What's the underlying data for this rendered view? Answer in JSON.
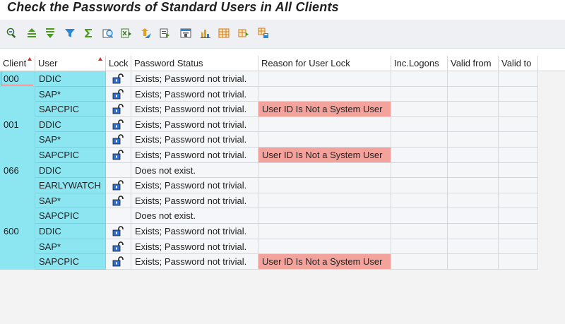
{
  "window": {
    "title": "Check the Passwords of Standard Users in All Clients"
  },
  "toolbar": {
    "icons": [
      "details-icon",
      "sort-ascending-icon",
      "sort-descending-icon",
      "filter-icon",
      "sum-icon",
      "print-preview-icon",
      "export-spreadsheet-icon",
      "local-file-icon",
      "mail-icon",
      "abc-analysis-icon",
      "graphic-icon",
      "layout-icon",
      "select-layout-icon",
      "save-layout-icon"
    ]
  },
  "table": {
    "columns": [
      {
        "key": "client",
        "label": "Client",
        "sorted": true
      },
      {
        "key": "user",
        "label": "User",
        "sorted": true
      },
      {
        "key": "lock",
        "label": "Lock",
        "sorted": false
      },
      {
        "key": "status",
        "label": "Password Status",
        "sorted": false
      },
      {
        "key": "reason",
        "label": "Reason for User Lock",
        "sorted": false
      },
      {
        "key": "logons",
        "label": "Inc.Logons",
        "sorted": false
      },
      {
        "key": "valid_from",
        "label": "Valid from",
        "sorted": false
      },
      {
        "key": "valid_to",
        "label": "Valid to",
        "sorted": false
      }
    ],
    "rows": [
      {
        "client": "000",
        "user": "DDIC",
        "lock": true,
        "status": "Exists; Password not trivial.",
        "reason": ""
      },
      {
        "client": "",
        "user": "SAP*",
        "lock": true,
        "status": "Exists; Password not trivial.",
        "reason": ""
      },
      {
        "client": "",
        "user": "SAPCPIC",
        "lock": true,
        "status": "Exists; Password not trivial.",
        "reason": "User ID Is Not a System User"
      },
      {
        "client": "001",
        "user": "DDIC",
        "lock": true,
        "status": "Exists; Password not trivial.",
        "reason": ""
      },
      {
        "client": "",
        "user": "SAP*",
        "lock": true,
        "status": "Exists; Password not trivial.",
        "reason": ""
      },
      {
        "client": "",
        "user": "SAPCPIC",
        "lock": true,
        "status": "Exists; Password not trivial.",
        "reason": "User ID Is Not a System User"
      },
      {
        "client": "066",
        "user": "DDIC",
        "lock": false,
        "status": "Does not exist.",
        "reason": ""
      },
      {
        "client": "",
        "user": "EARLYWATCH",
        "lock": true,
        "status": "Exists; Password not trivial.",
        "reason": ""
      },
      {
        "client": "",
        "user": "SAP*",
        "lock": true,
        "status": "Exists; Password not trivial.",
        "reason": ""
      },
      {
        "client": "",
        "user": "SAPCPIC",
        "lock": false,
        "status": "Does not exist.",
        "reason": ""
      },
      {
        "client": "600",
        "user": "DDIC",
        "lock": true,
        "status": "Exists; Password not trivial.",
        "reason": ""
      },
      {
        "client": "",
        "user": "SAP*",
        "lock": true,
        "status": "Exists; Password not trivial.",
        "reason": ""
      },
      {
        "client": "",
        "user": "SAPCPIC",
        "lock": true,
        "status": "Exists; Password not trivial.",
        "reason": "User ID Is Not a System User"
      }
    ]
  },
  "colors": {
    "key_column": "#8ce6f2",
    "error_cell": "#f4a39c",
    "header_bg": "#ffffff",
    "grid_bg": "#f5f6f7"
  }
}
